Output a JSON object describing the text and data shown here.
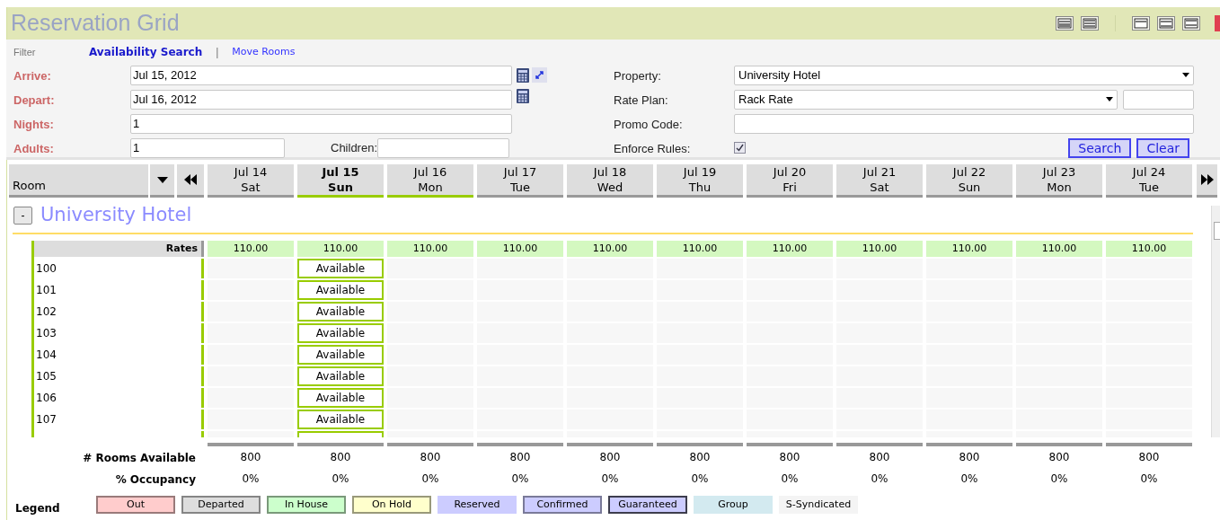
{
  "title": "Reservation Grid",
  "filter": {
    "label": "Filter",
    "separator": "|",
    "tabs": [
      {
        "label": "Availability Search",
        "selected": true
      },
      {
        "label": "Move Rooms",
        "selected": false
      }
    ]
  },
  "form": {
    "arrive": {
      "label": "Arrive:",
      "value": "Jul 15, 2012"
    },
    "depart": {
      "label": "Depart:",
      "value": "Jul 16, 2012"
    },
    "nights": {
      "label": "Nights:",
      "value": "1"
    },
    "adults": {
      "label": "Adults:",
      "value": "1"
    },
    "children": {
      "label": "Children:"
    },
    "property": {
      "label": "Property:",
      "value": "University Hotel"
    },
    "rate_plan": {
      "label": "Rate Plan:",
      "value": "Rack Rate"
    },
    "promo_code": {
      "label": "Promo Code:"
    },
    "enforce_rules": {
      "label": "Enforce Rules:",
      "checked": true
    },
    "buttons": [
      "Search",
      "Clear"
    ]
  },
  "grid": {
    "room_header": "Room",
    "days": [
      {
        "date": "Jul 14",
        "weekday": "Sat",
        "selected": false,
        "in_stay": false
      },
      {
        "date": "Jul 15",
        "weekday": "Sun",
        "selected": true,
        "in_stay": true
      },
      {
        "date": "Jul 16",
        "weekday": "Mon",
        "selected": false,
        "in_stay": true
      },
      {
        "date": "Jul 17",
        "weekday": "Tue",
        "selected": false,
        "in_stay": false
      },
      {
        "date": "Jul 18",
        "weekday": "Wed",
        "selected": false,
        "in_stay": false
      },
      {
        "date": "Jul 19",
        "weekday": "Thu",
        "selected": false,
        "in_stay": false
      },
      {
        "date": "Jul 20",
        "weekday": "Fri",
        "selected": false,
        "in_stay": false
      },
      {
        "date": "Jul 21",
        "weekday": "Sat",
        "selected": false,
        "in_stay": false
      },
      {
        "date": "Jul 22",
        "weekday": "Sun",
        "selected": false,
        "in_stay": false
      },
      {
        "date": "Jul 23",
        "weekday": "Mon",
        "selected": false,
        "in_stay": false
      },
      {
        "date": "Jul 24",
        "weekday": "Tue",
        "selected": false,
        "in_stay": false
      }
    ],
    "property": {
      "name": "University Hotel",
      "toggle": "-"
    },
    "rates_label": "Rates",
    "rates": [
      "110.00",
      "110.00",
      "110.00",
      "110.00",
      "110.00",
      "110.00",
      "110.00",
      "110.00",
      "110.00",
      "110.00",
      "110.00"
    ],
    "rooms": [
      {
        "number": "100",
        "status": "Available"
      },
      {
        "number": "101",
        "status": "Available"
      },
      {
        "number": "102",
        "status": "Available"
      },
      {
        "number": "103",
        "status": "Available"
      },
      {
        "number": "104",
        "status": "Available"
      },
      {
        "number": "105",
        "status": "Available"
      },
      {
        "number": "106",
        "status": "Available"
      },
      {
        "number": "107",
        "status": "Available"
      }
    ],
    "summary": [
      {
        "label": "# Rooms Available",
        "values": [
          "800",
          "800",
          "800",
          "800",
          "800",
          "800",
          "800",
          "800",
          "800",
          "800",
          "800"
        ]
      },
      {
        "label": "% Occupancy",
        "values": [
          "0%",
          "0%",
          "0%",
          "0%",
          "0%",
          "0%",
          "0%",
          "0%",
          "0%",
          "0%",
          "0%"
        ]
      }
    ]
  },
  "legend": {
    "title": "Legend",
    "items": [
      {
        "label": "Out",
        "color": "#ffcccc",
        "kind": "outlined"
      },
      {
        "label": "Departed",
        "color": "#dddddd",
        "kind": "outlined"
      },
      {
        "label": "In House",
        "color": "#ccffcc",
        "kind": "outlined"
      },
      {
        "label": "On Hold",
        "color": "#ffffcc",
        "kind": "outlined"
      },
      {
        "label": "Reserved",
        "color": "#ccccff",
        "kind": "plain"
      },
      {
        "label": "Confirmed",
        "color": "#ccccff",
        "kind": "outlined"
      },
      {
        "label": "Guaranteed",
        "color": "#ccccff",
        "kind": "emphasized"
      },
      {
        "label": "Group",
        "color": "#d3eaf0",
        "kind": "plain"
      },
      {
        "label": "S-Syndicated",
        "color": "#f4f4f4",
        "kind": "plain"
      }
    ]
  }
}
